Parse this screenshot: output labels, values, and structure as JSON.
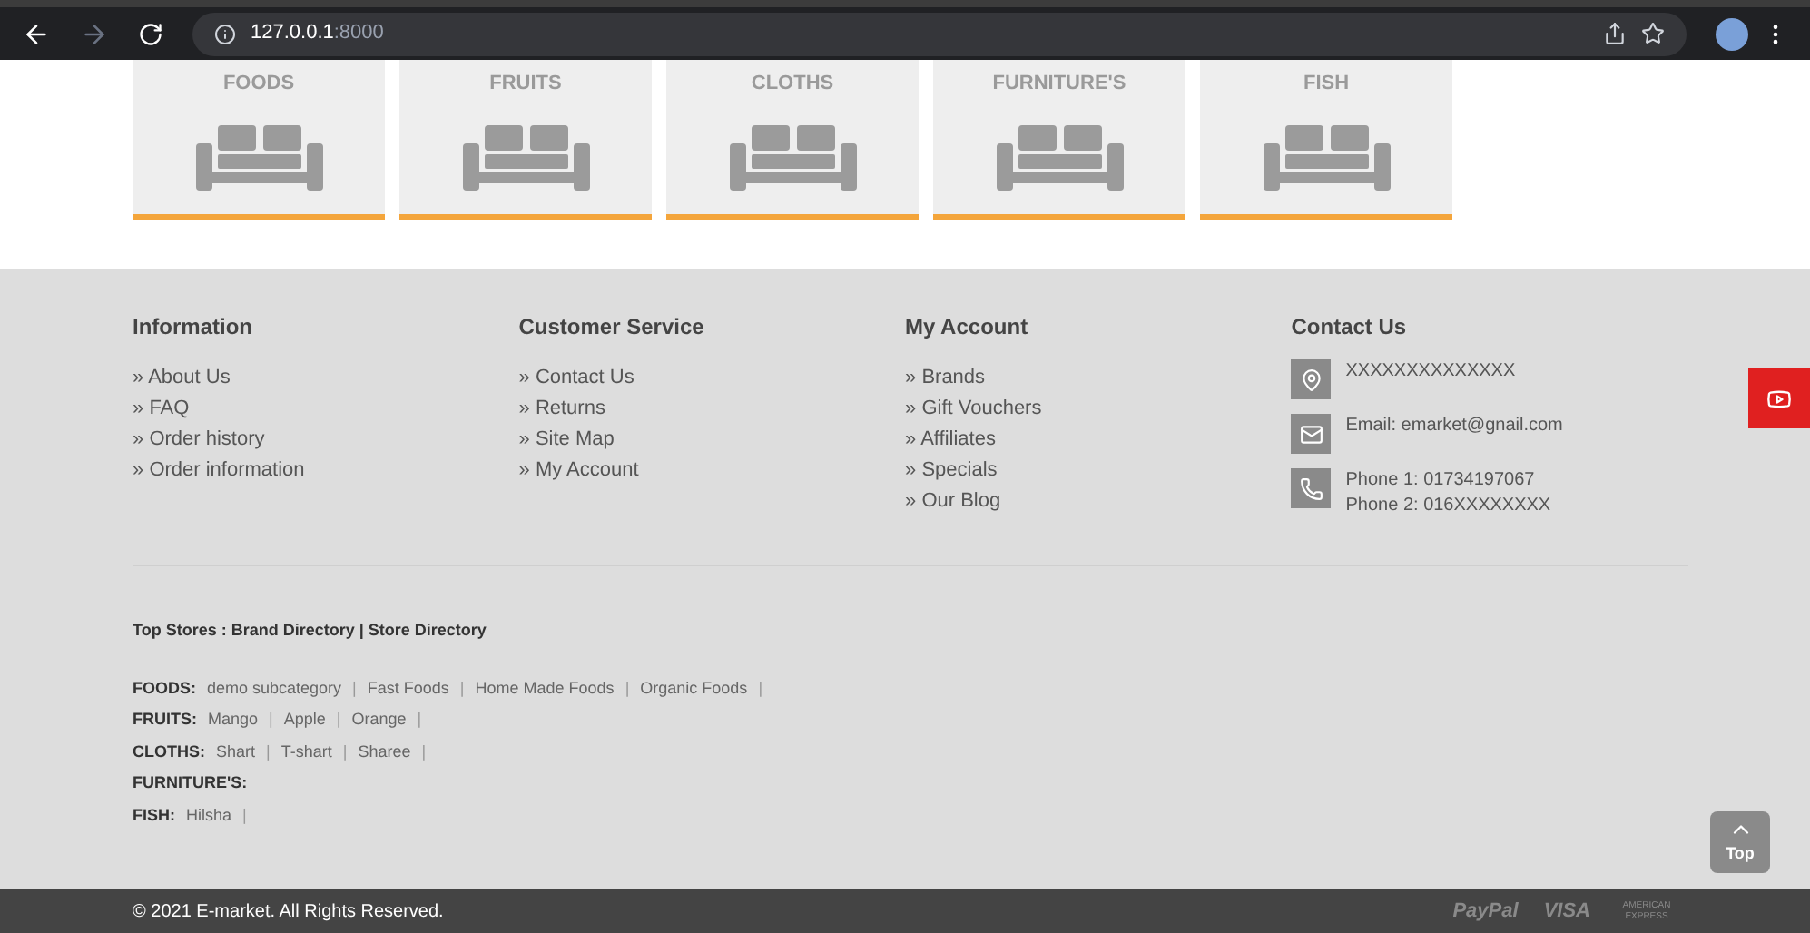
{
  "browser": {
    "url_host": "127.0.0.1",
    "url_port": ":8000"
  },
  "categories": [
    {
      "label": "FOODS"
    },
    {
      "label": "FRUITS"
    },
    {
      "label": "CLOTHS"
    },
    {
      "label": "FURNITURE'S"
    },
    {
      "label": "FISH"
    }
  ],
  "footer_columns": [
    {
      "heading": "Information",
      "links": [
        "About Us",
        "FAQ",
        "Order history",
        "Order information"
      ]
    },
    {
      "heading": "Customer Service",
      "links": [
        "Contact Us",
        "Returns",
        "Site Map",
        "My Account"
      ]
    },
    {
      "heading": "My Account",
      "links": [
        "Brands",
        "Gift Vouchers",
        "Affiliates",
        "Specials",
        "Our Blog"
      ]
    }
  ],
  "link_marker": "»",
  "contact": {
    "heading": "Contact Us",
    "items": [
      {
        "kind": "address",
        "lines": [
          "XXXXXXXXXXXXXX"
        ]
      },
      {
        "kind": "email",
        "lines": [
          "Email: emarket@gnail.com"
        ]
      },
      {
        "kind": "phone",
        "lines": [
          "Phone 1: 01734197067",
          "Phone 2: 016XXXXXXXX"
        ]
      }
    ]
  },
  "top_stores": "Top Stores : Brand Directory | Store Directory",
  "separator": "|",
  "subcategories": [
    {
      "label": "FOODS:",
      "items": [
        "demo subcategory",
        "Fast Foods",
        "Home Made Foods",
        "Organic Foods"
      ]
    },
    {
      "label": "FRUITS:",
      "items": [
        "Mango",
        "Apple",
        "Orange"
      ]
    },
    {
      "label": "CLOTHS:",
      "items": [
        "Shart",
        "T-shart",
        "Sharee"
      ]
    },
    {
      "label": "FURNITURE'S:"
    },
    {
      "label": "FISH:",
      "items": [
        "Hilsha"
      ]
    }
  ],
  "top_button": "Top",
  "copyright": "© 2021 E-market. All Rights Reserved.",
  "payments": [
    "PayPal",
    "VISA",
    "AMERICAN EXPRESS"
  ]
}
